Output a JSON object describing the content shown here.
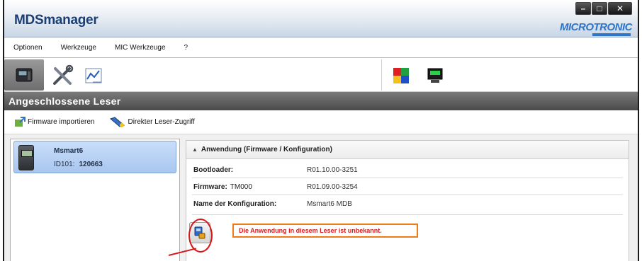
{
  "window": {
    "title": "MDSmanager",
    "brand": "MICROTRONIC",
    "controls": {
      "minimize": "–",
      "maximize": "□",
      "close": "✕"
    }
  },
  "menu": {
    "items": [
      "Optionen",
      "Werkzeuge",
      "MIC Werkzeuge",
      "?"
    ]
  },
  "toolbar": {
    "icons": [
      "reader-device-icon",
      "tools-icon",
      "chart-icon",
      "modules-icon",
      "reader-terminal-icon"
    ]
  },
  "section": {
    "title": "Angeschlossene Leser"
  },
  "actions": {
    "import_label": "Firmware importieren",
    "direct_label": "Direkter Leser-Zugriff"
  },
  "reader": {
    "name": "Msmart6",
    "id_label": "ID101:",
    "id_value": "120663"
  },
  "panel": {
    "heading": "Anwendung (Firmware / Konfiguration)",
    "rows": [
      {
        "key": "Bootloader:",
        "sub": "",
        "value": "R01.10.00-3251"
      },
      {
        "key": "Firmware:",
        "sub": "TM000",
        "value": "R01.09.00-3254"
      },
      {
        "key": "Name der Konfiguration:",
        "sub": "",
        "value": "Msmart6 MDB"
      }
    ],
    "warning": "Die Anwendung in diesem Leser ist unbekannt."
  },
  "colors": {
    "accent_blue": "#2e74c7",
    "warning_text": "#d81b1b",
    "warning_border": "#f07a16",
    "highlight_circle": "#d8161a"
  }
}
